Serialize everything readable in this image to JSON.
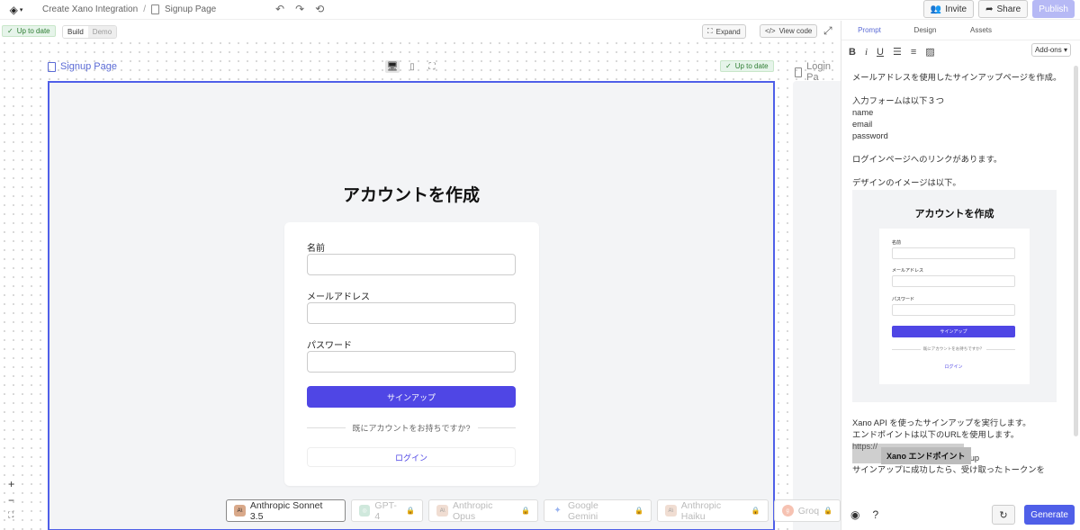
{
  "header": {
    "crumb_project": "Create Xano Integration",
    "crumb_sep": "/",
    "crumb_page": "Signup Page",
    "invite_label": "Invite",
    "share_label": "Share",
    "publish_label": "Publish"
  },
  "canvas_toolbar": {
    "status_label": "Up to date",
    "mode_build": "Build",
    "mode_demo": "Demo",
    "expand_label": "Expand",
    "view_code_label": "View code"
  },
  "frame": {
    "page_label": "Signup Page",
    "status_label": "Up to date",
    "next_page_label": "Login Pa",
    "title": "アカウントを作成",
    "name_label": "名前",
    "email_label": "メールアドレス",
    "password_label": "パスワード",
    "submit_label": "サインアップ",
    "divider_text": "既にアカウントをお持ちですか?",
    "login_label": "ログイン"
  },
  "zoom": {
    "in": "+",
    "out": "−",
    "fit": "⛶"
  },
  "models": [
    {
      "label": "Anthropic Sonnet 3.5",
      "icon": "A\\",
      "active": true
    },
    {
      "label": "GPT-4",
      "icon": "◎",
      "active": false
    },
    {
      "label": "Anthropic Opus",
      "icon": "A\\",
      "active": false
    },
    {
      "label": "Google Gemini",
      "icon": "✦",
      "active": false
    },
    {
      "label": "Anthropic Haiku",
      "icon": "A\\",
      "active": false
    },
    {
      "label": "Groq",
      "icon": "g",
      "active": false
    }
  ],
  "panel": {
    "tabs": [
      "Prompt",
      "Design",
      "Assets"
    ],
    "addons_label": "Add-ons",
    "prompt_lines": [
      "メールアドレスを使用したサインアップページを作成。",
      "",
      "入力フォームは以下３つ",
      "name",
      "email",
      "password",
      "",
      "ログインページへのリンクがあります。",
      "",
      "デザインのイメージは以下。"
    ],
    "design_image": {
      "title": "アカウントを作成",
      "name_label": "名前",
      "email_label": "メールアドレス",
      "password_label": "パスワード",
      "submit_label": "サインアップ",
      "divider_text": "既にアカウントをお持ちですか？",
      "login_label": "ログイン"
    },
    "prompt_lines_2": [
      "Xano API を使ったサインアップを実行します。",
      "エンドポイントは以下のURLを使用します。",
      "https://",
      "                                   /auth/signup",
      "",
      "",
      "サインアップに成功したら、受け取ったトークンを"
    ],
    "tooltip": "Xano エンドポイント",
    "generate_label": "Generate"
  }
}
